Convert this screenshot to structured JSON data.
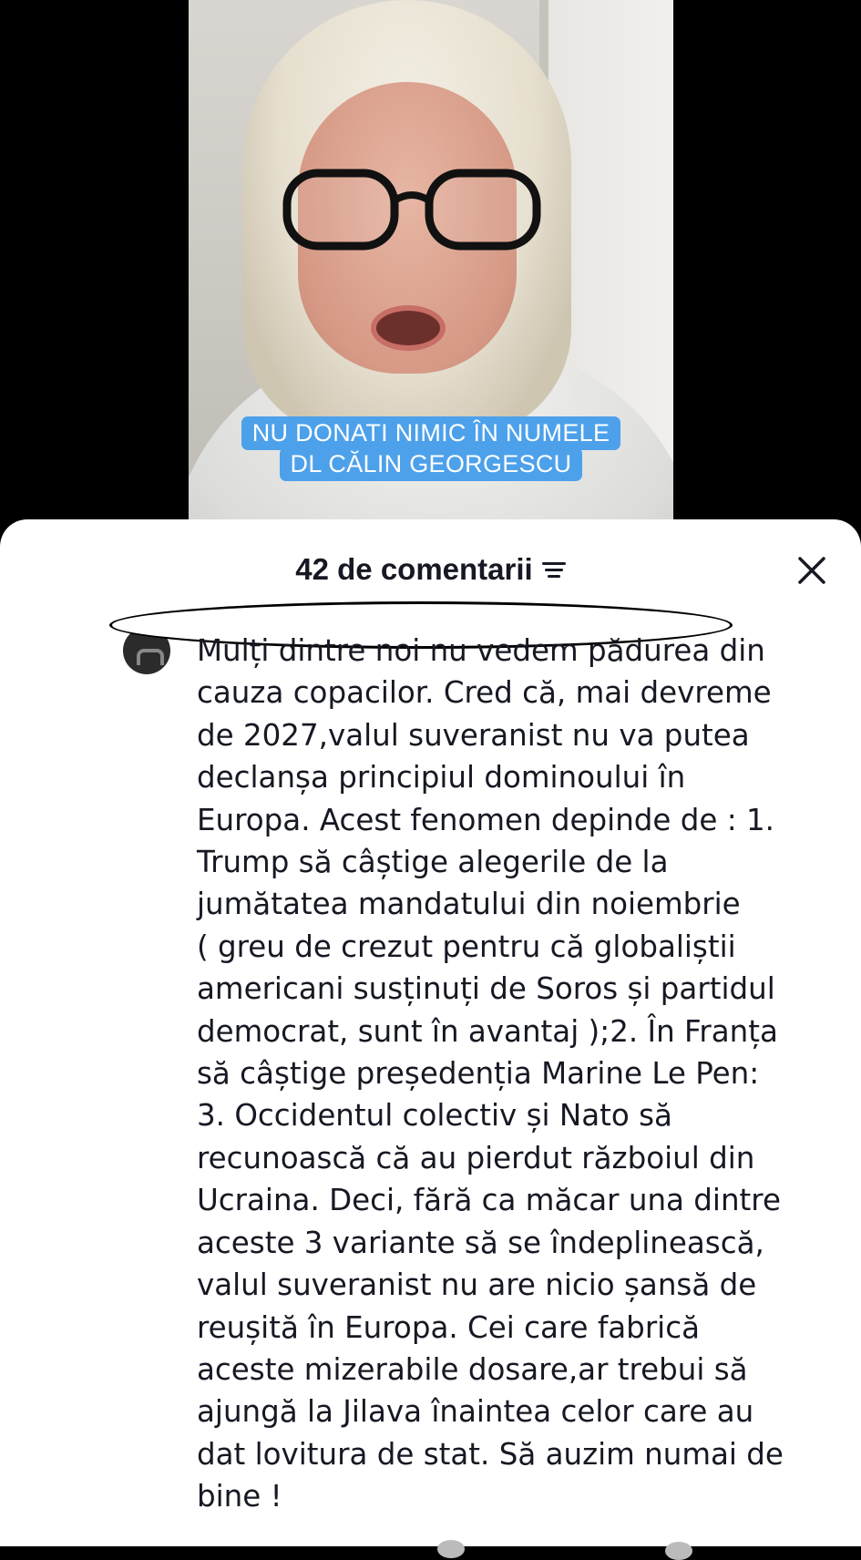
{
  "video": {
    "caption_line1": "NU DONATI NIMIC ÎN NUMELE",
    "caption_line2": "DL CĂLIN GEORGESCU"
  },
  "comments_sheet": {
    "title": "42 de comentarii",
    "sort_icon": "sort-lines-icon",
    "close_icon": "close-icon",
    "comment": {
      "text": "Mulți dintre noi nu vedem pădurea din\ncauza copacilor. Cred că, mai devreme\nde 2027,valul suveranist nu va putea\ndeclanșa principiul dominoului în\nEuropa. Acest fenomen depinde de : 1.\nTrump să câștige alegerile de la\njumătatea mandatului din noiembrie\n( greu de crezut pentru că globaliștii\namericani susținuți de Soros și partidul\ndemocrat, sunt în avantaj );2. În Franța\nsă câștige președenția Marine Le Pen:\n3. Occidentul colectiv și Nato să\nrecunoască că au pierdut războiul din\nUcraina. Deci, fără ca măcar una dintre\naceste 3 variante să se îndeplinească,\nvalul suveranist nu are nicio șansă de\nreușită în Europa. Cei care fabrică\naceste mizerabile dosare,ar trebui să\najungă la Jilava înaintea celor care au\ndat lovitura de stat. Să auzim numai de\nbine !"
    }
  },
  "colors": {
    "caption_bg": "#4da1ea",
    "sheet_bg": "#ffffff",
    "text": "#161823"
  }
}
